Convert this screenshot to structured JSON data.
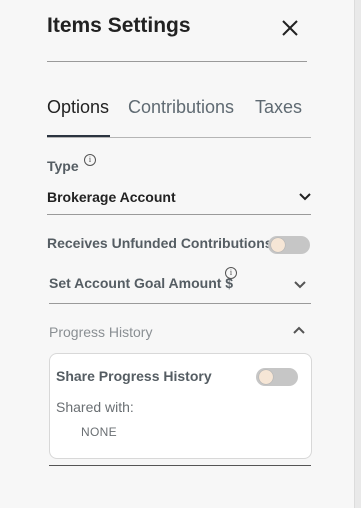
{
  "header": {
    "title": "Items Settings",
    "close_icon": "close-icon"
  },
  "tabs": [
    {
      "label": "Options",
      "active": true
    },
    {
      "label": "Contributions",
      "active": false
    },
    {
      "label": "Taxes",
      "active": false
    }
  ],
  "type_field": {
    "label": "Type",
    "value": "Brokerage Account"
  },
  "unfunded": {
    "label": "Receives Unfunded Contributions",
    "enabled": false
  },
  "goal": {
    "label": "Set Account Goal Amount $"
  },
  "progress_history": {
    "title": "Progress History",
    "expanded": true,
    "share_label": "Share Progress History",
    "share_enabled": false,
    "shared_with_label": "Shared with:",
    "shared_with_value": "NONE"
  },
  "colors": {
    "accent_underline": "#2b3440",
    "toggle_off": "#c6c6c6",
    "toggle_knob": "#f6e6d6"
  }
}
